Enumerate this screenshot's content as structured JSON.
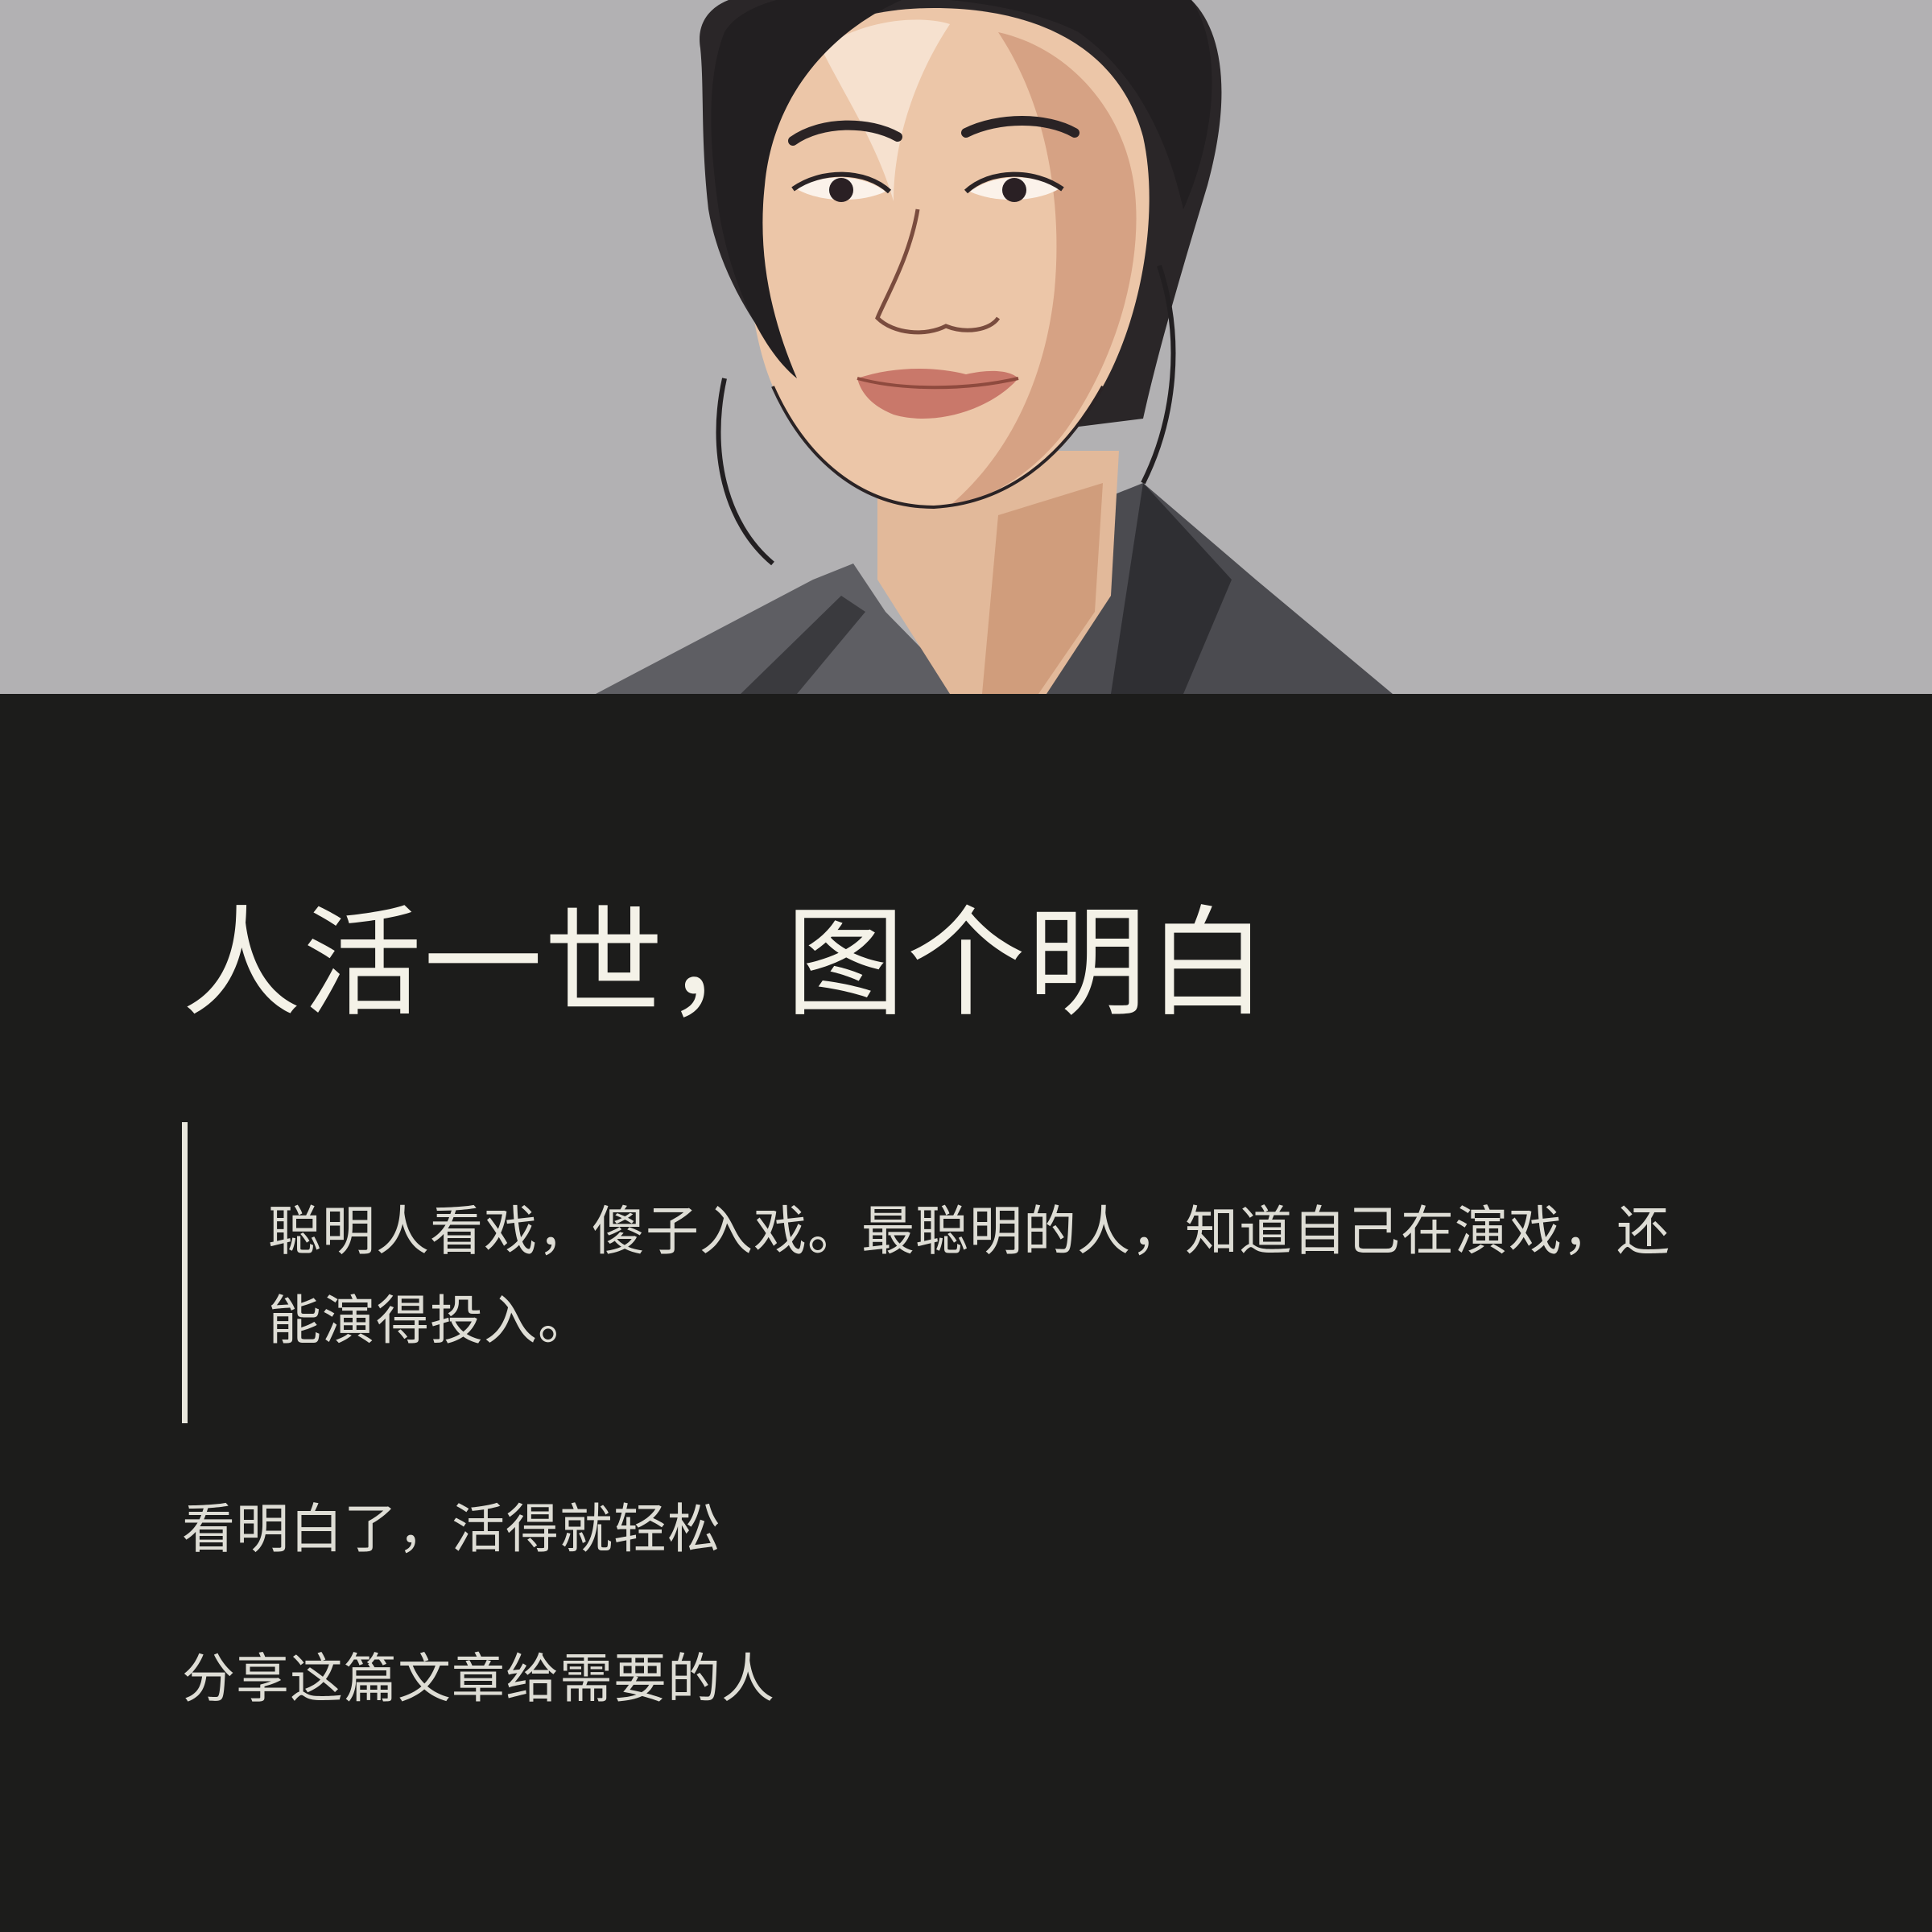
{
  "hero": {
    "image": "illustrated-portrait-of-smiling-woman",
    "background_color": "#b2b1b3"
  },
  "article": {
    "title": "人活一世，图个明白",
    "quote": "聪明人看戏，傻子入戏。最聪明的人，知道自己在演戏，还能演得投入。",
    "line_1": "看明白了，活得就轻松",
    "line_2": "分享这篇文章给需要的人"
  },
  "colors": {
    "page_background": "#1c1c1b",
    "title_text": "#f4f2e8",
    "body_text": "#deddd5",
    "quote_bar": "#e8e6dc"
  }
}
